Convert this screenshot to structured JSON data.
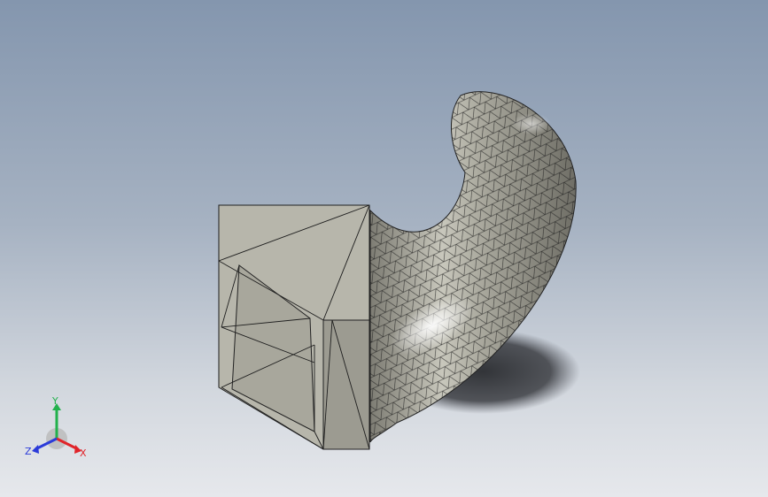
{
  "viewport": {
    "background_top": "#8496ae",
    "background_bottom": "#e6e8ec",
    "model": {
      "surface_color": "#a9a89c",
      "mesh_line_color": "#1b1b1b",
      "shadow_color": "#3a3c41"
    }
  },
  "triad": {
    "y_label": "Y",
    "x_label": "X",
    "z_label": "Z",
    "y_color": "#22b14c",
    "x_color": "#e0242a",
    "z_color": "#2b3bd9"
  }
}
